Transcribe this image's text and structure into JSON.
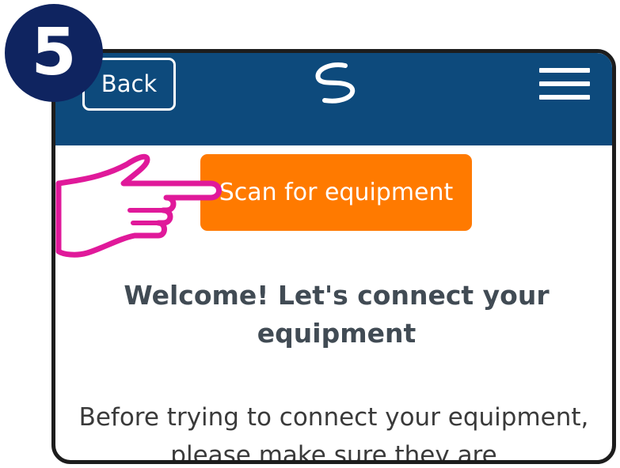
{
  "step": {
    "number": "5"
  },
  "header": {
    "back_label": "Back",
    "logo_icon": "swirl-logo-icon",
    "menu_icon": "hamburger-menu-icon",
    "background_color": "#0d4a7c"
  },
  "main": {
    "scan_button_label": "Scan for equipment",
    "scan_button_color": "#ff7a00",
    "welcome_title": "Welcome! Let's connect your equipment",
    "intro_text": "Before trying to connect your equipment, please make sure they are"
  },
  "annotation": {
    "hand_icon": "pointing-hand-icon",
    "color": "#e0199a"
  }
}
